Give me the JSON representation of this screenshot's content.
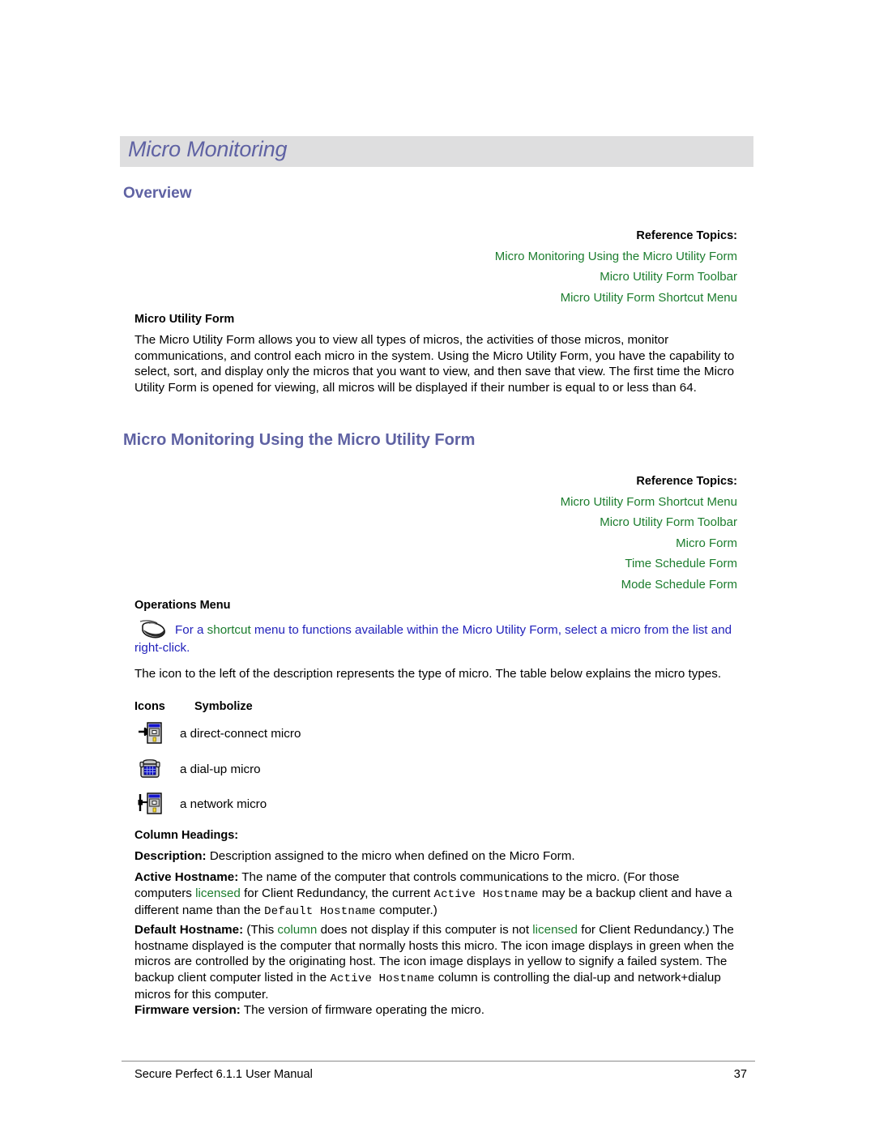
{
  "document": {
    "chapter_title": "Micro Monitoring"
  },
  "overview": {
    "heading": "Overview",
    "reference_title": "Reference Topics:",
    "reference_links": [
      "Micro Monitoring Using the Micro Utility Form",
      "Micro Utility Form Toolbar",
      "Micro Utility Form Shortcut Menu"
    ],
    "subheading": "Micro Utility Form",
    "body": "The Micro Utility Form allows you to view all types of micros, the activities of those micros, monitor communications, and control each micro in the system. Using the Micro Utility Form, you have the capability to select, sort, and display only the micros that you want to view, and then save that view. The first time the Micro Utility Form is opened for viewing, all micros will be displayed if their number is equal to or less than 64."
  },
  "using_section": {
    "heading": "Micro Monitoring Using the Micro Utility Form",
    "reference_title": "Reference Topics:",
    "reference_links": [
      "Micro Utility Form Shortcut Menu",
      "Micro Utility Form Toolbar",
      "Micro Form",
      "Time Schedule Form",
      "Mode Schedule Form"
    ],
    "operations_heading": "Operations Menu",
    "shortcut_note": {
      "part1": "For a ",
      "link": "shortcut",
      "part2": " menu to functions available within the Micro Utility Form, select a micro from the list and right-click."
    },
    "icon_intro": "The icon to the left of the description represents the type of micro. The table below explains the micro types."
  },
  "icons_table": {
    "col1_header": "Icons",
    "col2_header": "Symbolize",
    "rows": [
      {
        "icon": "direct-connect-micro-icon",
        "label": "a direct-connect micro"
      },
      {
        "icon": "dial-up-micro-icon",
        "label": "a dial-up micro"
      },
      {
        "icon": "network-micro-icon",
        "label": "a network micro"
      }
    ]
  },
  "column_headings": {
    "heading": "Column Headings:",
    "description": {
      "term": "Description:",
      "text": " Description assigned to the micro when defined on the Micro Form."
    },
    "active_hostname": {
      "term": "Active Hostname:",
      "p1": " The name of the computer that controls communications to the micro. (For those computers ",
      "link1": "licensed",
      "p2": " for Client Redundancy, the current ",
      "mono1": "Active Hostname",
      "p3": " may be a backup client and have a different name than the ",
      "mono2": "Default Hostname",
      "p4": " computer.)"
    },
    "default_hostname": {
      "term": "Default Hostname:",
      "p1": " (This ",
      "link1": "column",
      "p2": " does not display if this computer is not ",
      "link2": "licensed",
      "p3": " for Client Redundancy.) The hostname displayed is the computer that normally hosts this micro. The icon image displays in green when the micros are controlled by the originating host. The icon image displays in yellow to signify a failed system. The backup client computer listed in the ",
      "mono1": "Active Hostname",
      "p4": " column is controlling the dial-up and network+dialup micros for this computer."
    },
    "firmware": {
      "term": "Firmware version:",
      "text": " The version of firmware operating the micro."
    }
  },
  "footer": {
    "left": "Secure Perfect 6.1.1 User Manual",
    "page_number": "37"
  },
  "colors": {
    "heading_purple": "#5f62a3",
    "link_green": "#1c7d2e",
    "note_blue": "#2222bb",
    "title_band_gray": "#dededf"
  }
}
